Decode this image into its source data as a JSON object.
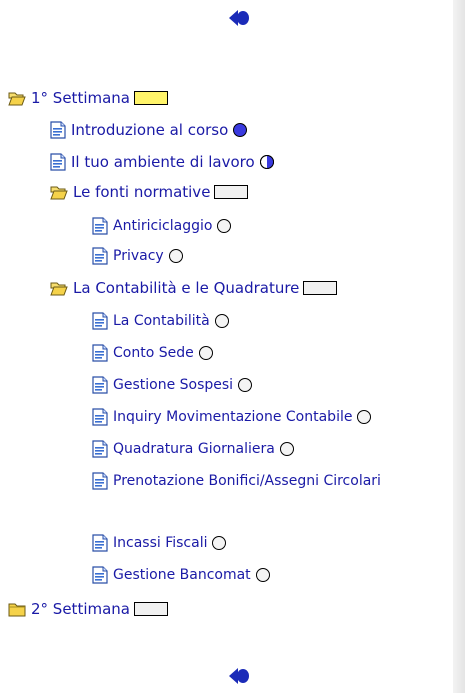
{
  "nav": {
    "top_icon": "back-arrow-icon",
    "bottom_icon": "back-arrow-icon"
  },
  "tree": [
    {
      "label": "1° Settimana",
      "icon": "folder-open-icon",
      "level": 0,
      "indicator": "box-yellow"
    },
    {
      "label": "Introduzione al corso",
      "icon": "document-icon",
      "level": 1,
      "indicator": "circle-full"
    },
    {
      "label": "Il tuo ambiente di lavoro",
      "icon": "document-icon",
      "level": 1,
      "indicator": "circle-half"
    },
    {
      "label": "Le fonti normative",
      "icon": "folder-open-icon",
      "level": 1,
      "indicator": "box-empty"
    },
    {
      "label": "Antiriciclaggio",
      "icon": "document-icon",
      "level": 2,
      "indicator": "circle-empty"
    },
    {
      "label": "Privacy",
      "icon": "document-icon",
      "level": 2,
      "indicator": "circle-empty"
    },
    {
      "label": "La Contabilità e le Quadrature",
      "icon": "folder-open-icon",
      "level": 1,
      "indicator": "box-empty"
    },
    {
      "label": "La Contabilità",
      "icon": "document-icon",
      "level": 2,
      "indicator": "circle-empty"
    },
    {
      "label": "Conto Sede",
      "icon": "document-icon",
      "level": 2,
      "indicator": "circle-empty"
    },
    {
      "label": "Gestione Sospesi",
      "icon": "document-icon",
      "level": 2,
      "indicator": "circle-empty"
    },
    {
      "label": "Inquiry Movimentazione Contabile",
      "icon": "document-icon",
      "level": 2,
      "indicator": "circle-empty"
    },
    {
      "label": "Quadratura Giornaliera",
      "icon": "document-icon",
      "level": 2,
      "indicator": "circle-empty"
    },
    {
      "label": "Prenotazione Bonifici/Assegni Circolari",
      "icon": "document-icon",
      "level": 2,
      "indicator": "none"
    },
    {
      "label": "Incassi Fiscali",
      "icon": "document-icon",
      "level": 2,
      "indicator": "circle-empty"
    },
    {
      "label": "Gestione Bancomat",
      "icon": "document-icon",
      "level": 2,
      "indicator": "circle-empty"
    },
    {
      "label": "2° Settimana",
      "icon": "folder-closed-icon",
      "level": 0,
      "indicator": "box-empty"
    }
  ],
  "colors": {
    "link": "#1a1aa6",
    "folder": "#f3d35a",
    "progress_full": "#3a3adf",
    "box_active": "#fff46a"
  }
}
